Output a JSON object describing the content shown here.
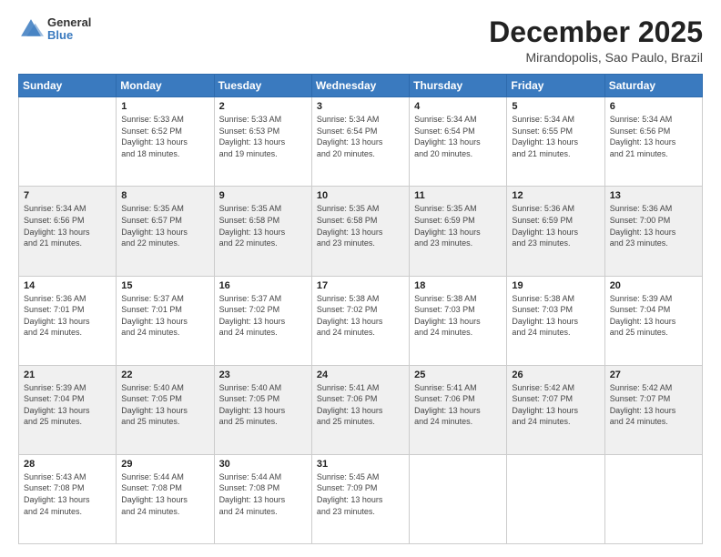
{
  "logo": {
    "general": "General",
    "blue": "Blue"
  },
  "header": {
    "month": "December 2025",
    "location": "Mirandopolis, Sao Paulo, Brazil"
  },
  "days_of_week": [
    "Sunday",
    "Monday",
    "Tuesday",
    "Wednesday",
    "Thursday",
    "Friday",
    "Saturday"
  ],
  "weeks": [
    [
      {
        "day": "",
        "info": ""
      },
      {
        "day": "1",
        "info": "Sunrise: 5:33 AM\nSunset: 6:52 PM\nDaylight: 13 hours\nand 18 minutes."
      },
      {
        "day": "2",
        "info": "Sunrise: 5:33 AM\nSunset: 6:53 PM\nDaylight: 13 hours\nand 19 minutes."
      },
      {
        "day": "3",
        "info": "Sunrise: 5:34 AM\nSunset: 6:54 PM\nDaylight: 13 hours\nand 20 minutes."
      },
      {
        "day": "4",
        "info": "Sunrise: 5:34 AM\nSunset: 6:54 PM\nDaylight: 13 hours\nand 20 minutes."
      },
      {
        "day": "5",
        "info": "Sunrise: 5:34 AM\nSunset: 6:55 PM\nDaylight: 13 hours\nand 21 minutes."
      },
      {
        "day": "6",
        "info": "Sunrise: 5:34 AM\nSunset: 6:56 PM\nDaylight: 13 hours\nand 21 minutes."
      }
    ],
    [
      {
        "day": "7",
        "info": "Sunrise: 5:34 AM\nSunset: 6:56 PM\nDaylight: 13 hours\nand 21 minutes."
      },
      {
        "day": "8",
        "info": "Sunrise: 5:35 AM\nSunset: 6:57 PM\nDaylight: 13 hours\nand 22 minutes."
      },
      {
        "day": "9",
        "info": "Sunrise: 5:35 AM\nSunset: 6:58 PM\nDaylight: 13 hours\nand 22 minutes."
      },
      {
        "day": "10",
        "info": "Sunrise: 5:35 AM\nSunset: 6:58 PM\nDaylight: 13 hours\nand 23 minutes."
      },
      {
        "day": "11",
        "info": "Sunrise: 5:35 AM\nSunset: 6:59 PM\nDaylight: 13 hours\nand 23 minutes."
      },
      {
        "day": "12",
        "info": "Sunrise: 5:36 AM\nSunset: 6:59 PM\nDaylight: 13 hours\nand 23 minutes."
      },
      {
        "day": "13",
        "info": "Sunrise: 5:36 AM\nSunset: 7:00 PM\nDaylight: 13 hours\nand 23 minutes."
      }
    ],
    [
      {
        "day": "14",
        "info": "Sunrise: 5:36 AM\nSunset: 7:01 PM\nDaylight: 13 hours\nand 24 minutes."
      },
      {
        "day": "15",
        "info": "Sunrise: 5:37 AM\nSunset: 7:01 PM\nDaylight: 13 hours\nand 24 minutes."
      },
      {
        "day": "16",
        "info": "Sunrise: 5:37 AM\nSunset: 7:02 PM\nDaylight: 13 hours\nand 24 minutes."
      },
      {
        "day": "17",
        "info": "Sunrise: 5:38 AM\nSunset: 7:02 PM\nDaylight: 13 hours\nand 24 minutes."
      },
      {
        "day": "18",
        "info": "Sunrise: 5:38 AM\nSunset: 7:03 PM\nDaylight: 13 hours\nand 24 minutes."
      },
      {
        "day": "19",
        "info": "Sunrise: 5:38 AM\nSunset: 7:03 PM\nDaylight: 13 hours\nand 24 minutes."
      },
      {
        "day": "20",
        "info": "Sunrise: 5:39 AM\nSunset: 7:04 PM\nDaylight: 13 hours\nand 25 minutes."
      }
    ],
    [
      {
        "day": "21",
        "info": "Sunrise: 5:39 AM\nSunset: 7:04 PM\nDaylight: 13 hours\nand 25 minutes."
      },
      {
        "day": "22",
        "info": "Sunrise: 5:40 AM\nSunset: 7:05 PM\nDaylight: 13 hours\nand 25 minutes."
      },
      {
        "day": "23",
        "info": "Sunrise: 5:40 AM\nSunset: 7:05 PM\nDaylight: 13 hours\nand 25 minutes."
      },
      {
        "day": "24",
        "info": "Sunrise: 5:41 AM\nSunset: 7:06 PM\nDaylight: 13 hours\nand 25 minutes."
      },
      {
        "day": "25",
        "info": "Sunrise: 5:41 AM\nSunset: 7:06 PM\nDaylight: 13 hours\nand 24 minutes."
      },
      {
        "day": "26",
        "info": "Sunrise: 5:42 AM\nSunset: 7:07 PM\nDaylight: 13 hours\nand 24 minutes."
      },
      {
        "day": "27",
        "info": "Sunrise: 5:42 AM\nSunset: 7:07 PM\nDaylight: 13 hours\nand 24 minutes."
      }
    ],
    [
      {
        "day": "28",
        "info": "Sunrise: 5:43 AM\nSunset: 7:08 PM\nDaylight: 13 hours\nand 24 minutes."
      },
      {
        "day": "29",
        "info": "Sunrise: 5:44 AM\nSunset: 7:08 PM\nDaylight: 13 hours\nand 24 minutes."
      },
      {
        "day": "30",
        "info": "Sunrise: 5:44 AM\nSunset: 7:08 PM\nDaylight: 13 hours\nand 24 minutes."
      },
      {
        "day": "31",
        "info": "Sunrise: 5:45 AM\nSunset: 7:09 PM\nDaylight: 13 hours\nand 23 minutes."
      },
      {
        "day": "",
        "info": ""
      },
      {
        "day": "",
        "info": ""
      },
      {
        "day": "",
        "info": ""
      }
    ]
  ]
}
